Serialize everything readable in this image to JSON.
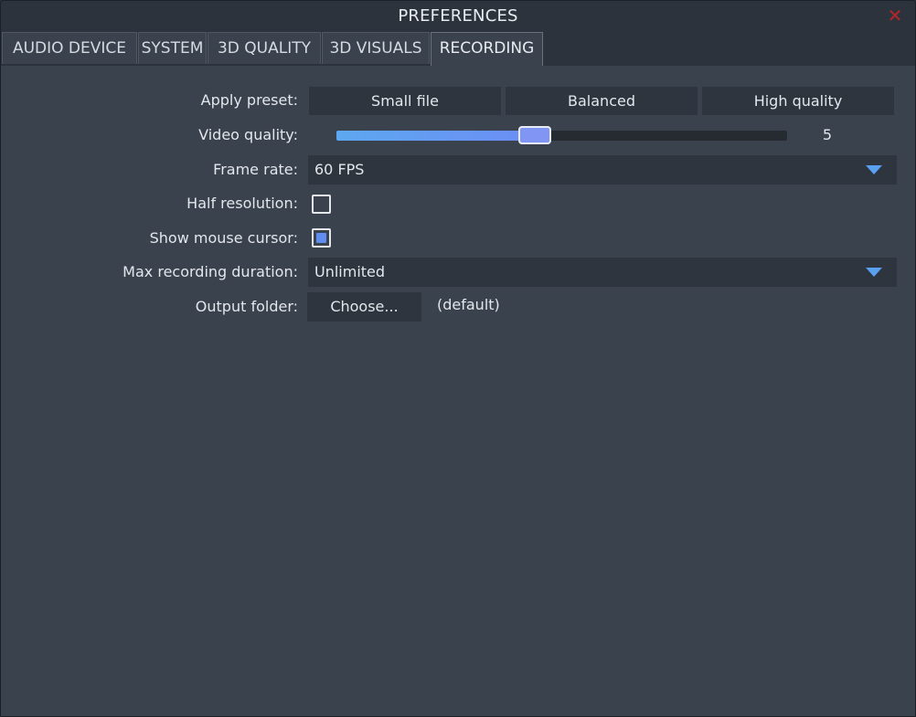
{
  "window": {
    "title": "PREFERENCES",
    "close_glyph": "✕"
  },
  "tabs": [
    {
      "label": "AUDIO DEVICE",
      "active": false
    },
    {
      "label": "SYSTEM",
      "active": false
    },
    {
      "label": "3D QUALITY",
      "active": false
    },
    {
      "label": "3D VISUALS",
      "active": false
    },
    {
      "label": "RECORDING",
      "active": true
    }
  ],
  "recording": {
    "apply_preset": {
      "label": "Apply preset:",
      "buttons": [
        "Small file",
        "Balanced",
        "High quality"
      ]
    },
    "video_quality": {
      "label": "Video quality:",
      "value": "5",
      "fraction": 0.44
    },
    "frame_rate": {
      "label": "Frame rate:",
      "value": "60 FPS"
    },
    "half_resolution": {
      "label": "Half resolution:",
      "checked": false
    },
    "show_mouse_cursor": {
      "label": "Show mouse cursor:",
      "checked": true
    },
    "max_recording_duration": {
      "label": "Max recording duration:",
      "value": "Unlimited"
    },
    "output_folder": {
      "label": "Output folder:",
      "button": "Choose...",
      "value": "(default)"
    }
  },
  "colors": {
    "accent": "#5aa0f0",
    "close": "#b3262a",
    "panel": "#3a424d"
  },
  "icons": {
    "close": "close-icon",
    "dropdown": "chevron-down-icon"
  }
}
